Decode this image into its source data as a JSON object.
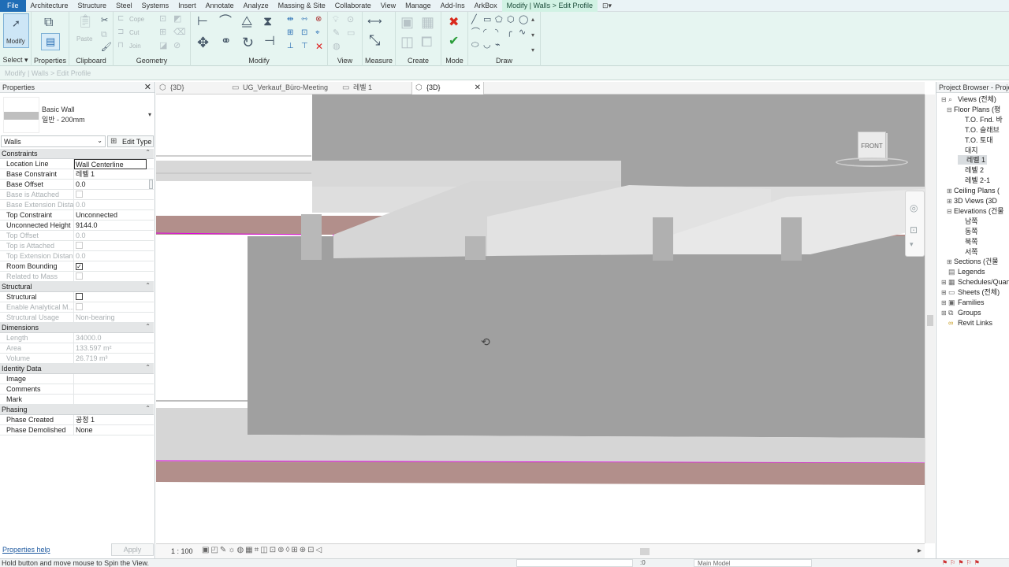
{
  "menu": {
    "tabs": [
      "File",
      "Architecture",
      "Structure",
      "Steel",
      "Systems",
      "Insert",
      "Annotate",
      "Analyze",
      "Massing & Site",
      "Collaborate",
      "View",
      "Manage",
      "Add-Ins",
      "ArkBox",
      "Modify | Walls > Edit Profile"
    ],
    "extra": "⊡▾"
  },
  "ribbon": {
    "select_label": "Select ▾",
    "modify_label": "Modify",
    "properties_label": "Properties",
    "clipboard": {
      "title": "Clipboard",
      "paste": "Paste",
      "cope": "Cope",
      "cut": "Cut",
      "join": "Join"
    },
    "geometry_title": "Geometry",
    "modify_title": "Modify",
    "view_title": "View",
    "measure_title": "Measure",
    "create_title": "Create",
    "mode_title": "Mode",
    "draw_title": "Draw"
  },
  "options_bar": {
    "text": "Modify | Walls > Edit Profile"
  },
  "properties": {
    "title": "Properties",
    "type_name": "Basic Wall",
    "type_sub": "일반 - 200mm",
    "instance_filter": "Walls",
    "edit_type": "Edit Type",
    "groups": [
      {
        "name": "Constraints",
        "rows": [
          {
            "k": "Location Line",
            "v": "Wall Centerline",
            "dim": false,
            "editing": true
          },
          {
            "k": "Base Constraint",
            "v": "레벨 1",
            "dim": false
          },
          {
            "k": "Base Offset",
            "v": "0.0",
            "dim": false
          },
          {
            "k": "Base is Attached",
            "v": "",
            "dim": true,
            "check": "empty"
          },
          {
            "k": "Base Extension Dista...",
            "v": "0.0",
            "dim": true
          },
          {
            "k": "Top Constraint",
            "v": "Unconnected",
            "dim": false
          },
          {
            "k": "Unconnected Height",
            "v": "9144.0",
            "dim": false
          },
          {
            "k": "Top Offset",
            "v": "0.0",
            "dim": true
          },
          {
            "k": "Top is Attached",
            "v": "",
            "dim": true,
            "check": "empty"
          },
          {
            "k": "Top Extension Distan...",
            "v": "0.0",
            "dim": true
          },
          {
            "k": "Room Bounding",
            "v": "",
            "dim": false,
            "check": "checked"
          },
          {
            "k": "Related to Mass",
            "v": "",
            "dim": true,
            "check": "empty"
          }
        ]
      },
      {
        "name": "Structural",
        "rows": [
          {
            "k": "Structural",
            "v": "",
            "dim": false,
            "check": "empty"
          },
          {
            "k": "Enable Analytical M...",
            "v": "",
            "dim": true,
            "check": "empty"
          },
          {
            "k": "Structural Usage",
            "v": "Non-bearing",
            "dim": true
          }
        ]
      },
      {
        "name": "Dimensions",
        "rows": [
          {
            "k": "Length",
            "v": "34000.0",
            "dim": true
          },
          {
            "k": "Area",
            "v": "133.597 m²",
            "dim": true
          },
          {
            "k": "Volume",
            "v": "26.719 m³",
            "dim": true
          }
        ]
      },
      {
        "name": "Identity Data",
        "rows": [
          {
            "k": "Image",
            "v": "",
            "dim": false
          },
          {
            "k": "Comments",
            "v": "",
            "dim": false
          },
          {
            "k": "Mark",
            "v": "",
            "dim": false
          }
        ]
      },
      {
        "name": "Phasing",
        "rows": [
          {
            "k": "Phase Created",
            "v": "공정 1",
            "dim": false
          },
          {
            "k": "Phase Demolished",
            "v": "None",
            "dim": false
          }
        ]
      }
    ],
    "help": "Properties help",
    "apply": "Apply"
  },
  "view_tabs": [
    {
      "label": "{3D}",
      "active": false
    },
    {
      "label": "UG_Verkauf_Büro-Meeting",
      "active": false
    },
    {
      "label": "레벨 1",
      "active": false
    },
    {
      "label": "{3D}",
      "active": true
    }
  ],
  "viewcube": {
    "face": "FRONT"
  },
  "view_control": {
    "scale": "1 : 100"
  },
  "browser": {
    "title": "Project Browser - Proje",
    "nodes": [
      {
        "label": "Views (전체)",
        "indent": 0,
        "toggle": "⊟",
        "icon": "⌕"
      },
      {
        "label": "Floor Plans (평",
        "indent": 1,
        "toggle": "⊟",
        "icon": ""
      },
      {
        "label": "T.O. Fnd. 바",
        "indent": 3,
        "toggle": "",
        "icon": ""
      },
      {
        "label": "T.O. 슬래브",
        "indent": 3,
        "toggle": "",
        "icon": ""
      },
      {
        "label": "T.O. 토대",
        "indent": 3,
        "toggle": "",
        "icon": ""
      },
      {
        "label": "대지",
        "indent": 3,
        "toggle": "",
        "icon": ""
      },
      {
        "label": "레벨 1",
        "indent": 3,
        "toggle": "",
        "icon": "",
        "selected": true
      },
      {
        "label": "레벨 2",
        "indent": 3,
        "toggle": "",
        "icon": ""
      },
      {
        "label": "레벨 2-1",
        "indent": 3,
        "toggle": "",
        "icon": ""
      },
      {
        "label": "Ceiling Plans (",
        "indent": 1,
        "toggle": "⊞",
        "icon": ""
      },
      {
        "label": "3D Views (3D",
        "indent": 1,
        "toggle": "⊞",
        "icon": ""
      },
      {
        "label": "Elevations (건물",
        "indent": 1,
        "toggle": "⊟",
        "icon": ""
      },
      {
        "label": "남쪽",
        "indent": 3,
        "toggle": "",
        "icon": ""
      },
      {
        "label": "동쪽",
        "indent": 3,
        "toggle": "",
        "icon": ""
      },
      {
        "label": "북쪽",
        "indent": 3,
        "toggle": "",
        "icon": ""
      },
      {
        "label": "서쪽",
        "indent": 3,
        "toggle": "",
        "icon": ""
      },
      {
        "label": "Sections (건물",
        "indent": 1,
        "toggle": "⊞",
        "icon": ""
      },
      {
        "label": "Legends",
        "indent": 0,
        "toggle": "",
        "icon": "▤"
      },
      {
        "label": "Schedules/Quan",
        "indent": 0,
        "toggle": "⊞",
        "icon": "▦"
      },
      {
        "label": "Sheets (전체)",
        "indent": 0,
        "toggle": "⊞",
        "icon": "▭"
      },
      {
        "label": "Families",
        "indent": 0,
        "toggle": "⊞",
        "icon": "▣"
      },
      {
        "label": "Groups",
        "indent": 0,
        "toggle": "⊞",
        "icon": "⧉"
      },
      {
        "label": "Revit Links",
        "indent": 0,
        "toggle": "",
        "icon": "∞",
        "link": true
      }
    ]
  },
  "status": {
    "message": "Hold button and move mouse to Spin the View.",
    "zero": ":0",
    "model": "Main Model"
  },
  "colors": {
    "wall_face": "#a0a0a0",
    "slab_top": "#dcdcdc",
    "section_cut": "#b28f8b",
    "profile_line": "#e000e0",
    "ribbon_bg": "#e6f5f1"
  }
}
